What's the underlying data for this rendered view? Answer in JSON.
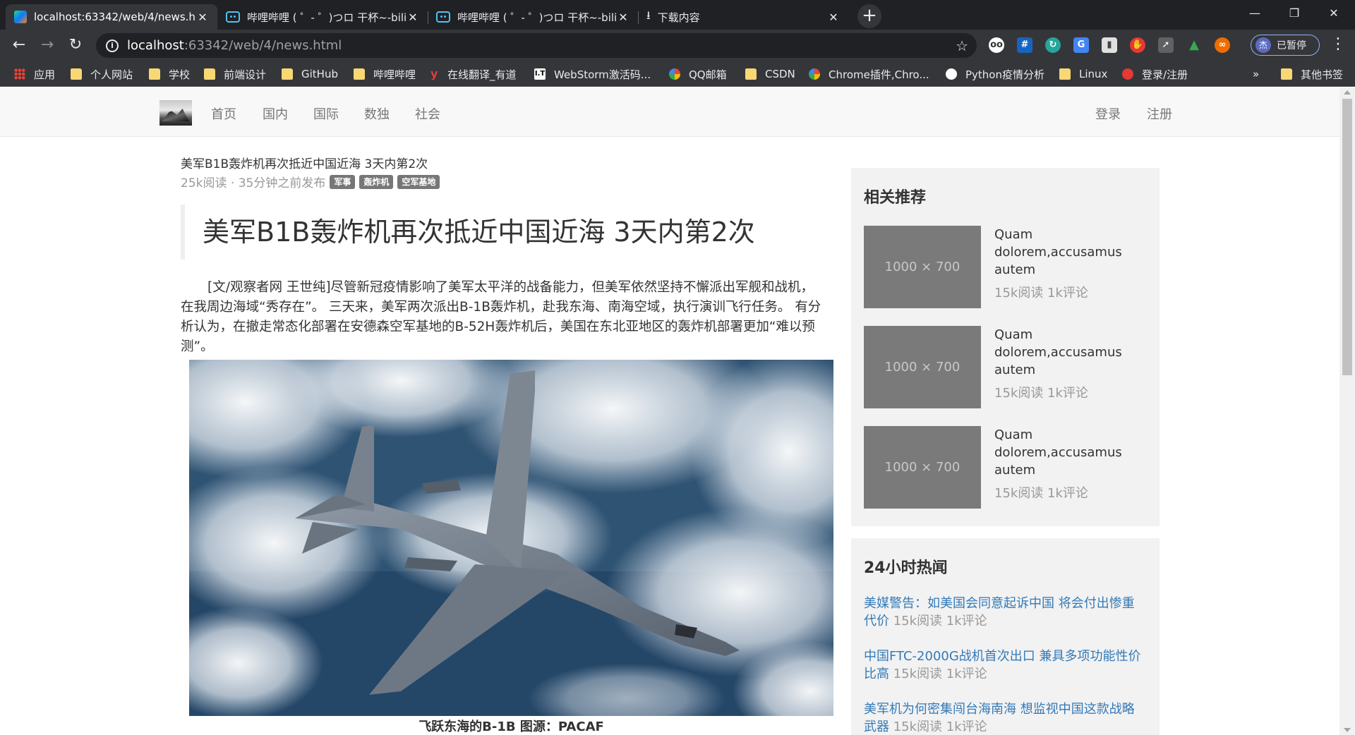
{
  "browser": {
    "tabs": [
      {
        "title": "localhost:63342/web/4/news.h",
        "icon": "webstorm-icon",
        "active": true
      },
      {
        "title": "哔哩哔哩 ( ゜- ゜)つロ 干杯~-bili",
        "icon": "bilibili-icon",
        "active": false
      },
      {
        "title": "哔哩哔哩 ( ゜- ゜)つロ 干杯~-bili",
        "icon": "bilibili-icon",
        "active": false
      },
      {
        "title": "下载内容",
        "icon": "download-icon",
        "active": false
      }
    ],
    "url_host": "localhost",
    "url_path": ":63342/web/4/news.html",
    "profile_label": "已暂停",
    "profile_initial": "杰",
    "bookmarks": [
      {
        "label": "应用",
        "icon": "apps"
      },
      {
        "label": "个人网站",
        "icon": "folder"
      },
      {
        "label": "学校",
        "icon": "folder"
      },
      {
        "label": "前端设计",
        "icon": "folder"
      },
      {
        "label": "GitHub",
        "icon": "folder"
      },
      {
        "label": "哔哩哔哩",
        "icon": "folder"
      },
      {
        "label": "在线翻译_有道",
        "icon": "youdao"
      },
      {
        "label": "WebStorm激活码...",
        "icon": "it"
      },
      {
        "label": "QQ邮箱",
        "icon": "google"
      },
      {
        "label": "CSDN",
        "icon": "folder"
      },
      {
        "label": "Chrome插件,Chro...",
        "icon": "google"
      },
      {
        "label": "Python疫情分析",
        "icon": "github"
      },
      {
        "label": "Linux",
        "icon": "folder"
      },
      {
        "label": "登录/注册",
        "icon": "csdn"
      },
      {
        "label": "»",
        "icon": "none"
      },
      {
        "label": "其他书签",
        "icon": "folder"
      }
    ]
  },
  "site": {
    "nav": [
      "首页",
      "国内",
      "国际",
      "数独",
      "社会"
    ],
    "login": "登录",
    "register": "注册"
  },
  "article": {
    "subtitle": "美军B1B轰炸机再次抵近中国近海 3天内第2次",
    "meta": "25k阅读 · 35分钟之前发布",
    "tags": [
      "军事",
      "轰炸机",
      "空军基地"
    ],
    "headline": "美军B1B轰炸机再次抵近中国近海 3天内第2次",
    "paragraph": "[文/观察者网 王世纯]尽管新冠疫情影响了美军太平洋的战备能力，但美军依然坚持不懈派出军舰和战机，在我周边海域“秀存在”。 三天来，美军两次派出B-1B轰炸机，赴我东海、南海空域，执行演训飞行任务。 有分析认为，在撤走常态化部署在安德森空军基地的B-52H轰炸机后，美国在东北亚地区的轰炸机部署更加“难以预测”。",
    "caption": "飞跃东海的B-1B 图源：PACAF"
  },
  "recommend": {
    "title": "相关推荐",
    "items": [
      {
        "placeholder": "1000 × 700",
        "title": "Quam dolorem,accusamus autem",
        "meta": "15k阅读 1k评论"
      },
      {
        "placeholder": "1000 × 700",
        "title": "Quam dolorem,accusamus autem",
        "meta": "15k阅读 1k评论"
      },
      {
        "placeholder": "1000 × 700",
        "title": "Quam dolorem,accusamus autem",
        "meta": "15k阅读 1k评论"
      }
    ]
  },
  "hot": {
    "title": "24小时热闻",
    "items": [
      {
        "title": "美媒警告：如美国会同意起诉中国 将会付出惨重代价",
        "meta": "15k阅读 1k评论"
      },
      {
        "title": "中国FTC-2000G战机首次出口 兼具多项功能性价比高",
        "meta": "15k阅读 1k评论"
      },
      {
        "title": "美军机为何密集闯台海南海 想监视中国这款战略武器",
        "meta": "15k阅读 1k评论"
      }
    ]
  }
}
